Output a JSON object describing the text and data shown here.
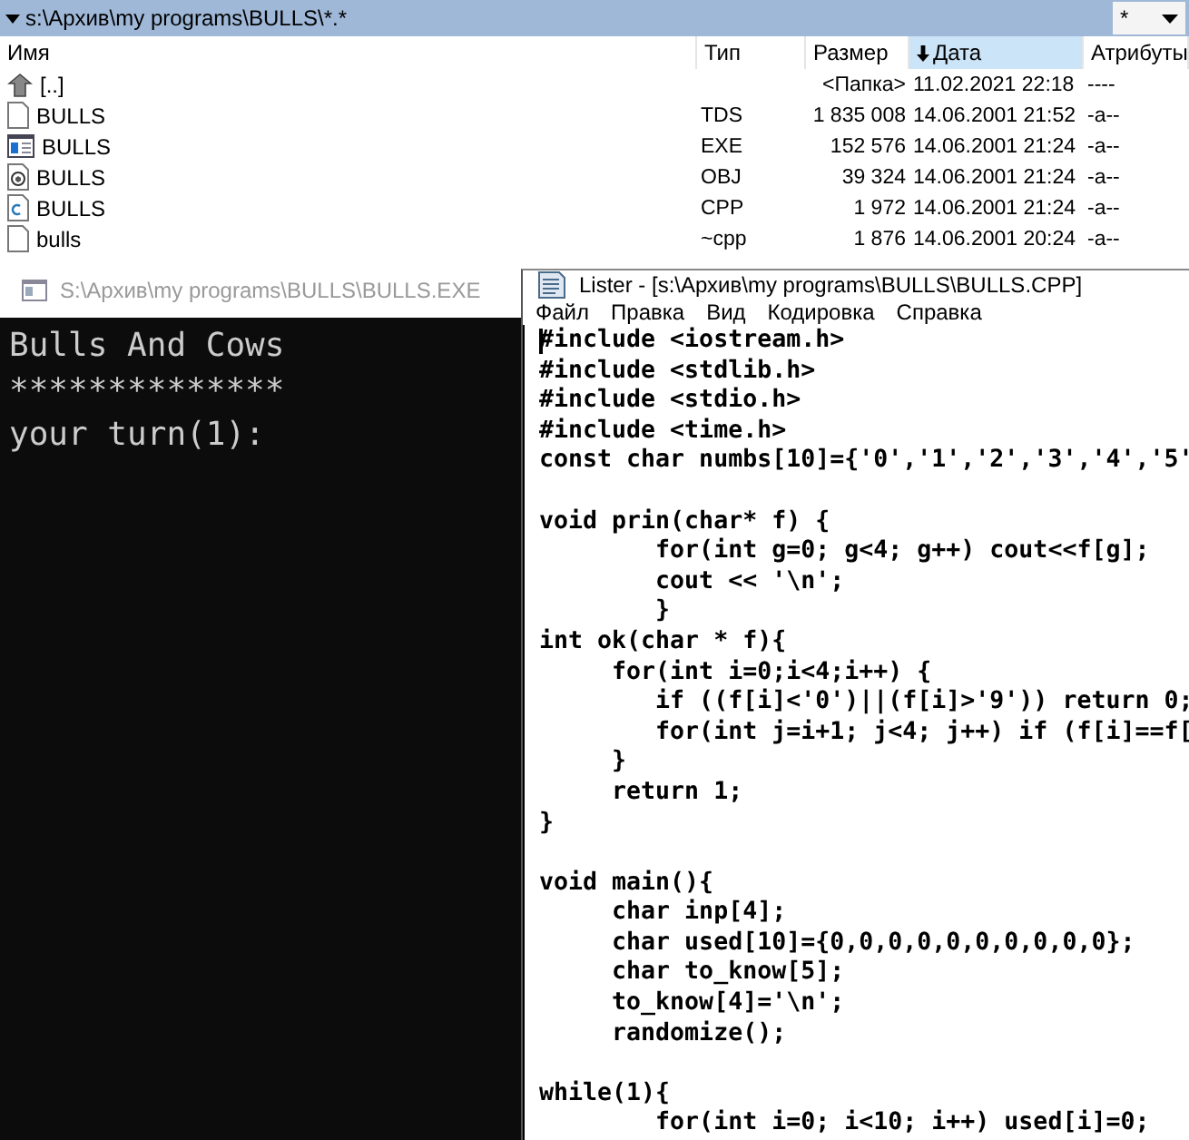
{
  "file_panel": {
    "path": "s:\\Архив\\my programs\\BULLS\\*.*",
    "filter_button": "*",
    "columns": [
      {
        "label": "Имя",
        "sorted": false
      },
      {
        "label": "Тип",
        "sorted": false
      },
      {
        "label": "Размер",
        "sorted": false
      },
      {
        "label": "Дата",
        "sorted": true
      },
      {
        "label": "Атрибуты",
        "sorted": false
      }
    ],
    "rows": [
      {
        "kind": "up",
        "name": "[..]",
        "size": "<Папка>",
        "date": "11.02.2021 22:18",
        "attributes": "----"
      },
      {
        "kind": "file",
        "name": "BULLS",
        "type": "TDS",
        "size": "1 835 008",
        "date": "14.06.2001 21:52",
        "attributes": "-a--"
      },
      {
        "kind": "exe",
        "name": "BULLS",
        "type": "EXE",
        "size": "152 576",
        "date": "14.06.2001 21:24",
        "attributes": "-a--"
      },
      {
        "kind": "obj",
        "name": "BULLS",
        "type": "OBJ",
        "size": "39 324",
        "date": "14.06.2001 21:24",
        "attributes": "-a--"
      },
      {
        "kind": "cpp",
        "name": "BULLS",
        "type": "CPP",
        "size": "1 972",
        "date": "14.06.2001 21:24",
        "attributes": "-a--"
      },
      {
        "kind": "file",
        "name": "bulls",
        "type": "~cpp",
        "size": "1 876",
        "date": "14.06.2001 20:24",
        "attributes": "-a--"
      }
    ]
  },
  "console": {
    "title": "S:\\Архив\\my programs\\BULLS\\BULLS.EXE",
    "lines": [
      "Bulls And Cows",
      "**************",
      "your turn(1):"
    ]
  },
  "lister": {
    "title": "Lister - [s:\\Архив\\my programs\\BULLS\\BULLS.CPP]",
    "menu": [
      "Файл",
      "Правка",
      "Вид",
      "Кодировка",
      "Справка"
    ],
    "code_blocks": [
      [
        "#include <iostream.h>",
        "#include <stdlib.h>",
        "#include <stdio.h>",
        "#include <time.h>",
        "const char numbs[10]={'0','1','2','3','4','5'"
      ],
      [
        "void prin(char* f) {",
        "        for(int g=0; g<4; g++) cout<<f[g];",
        "        cout << '\\n';",
        "        }",
        "int ok(char * f){",
        "     for(int i=0;i<4;i++) {",
        "        if ((f[i]<'0')||(f[i]>'9')) return 0;",
        "        for(int j=i+1; j<4; j++) if (f[i]==f[",
        "     }",
        "     return 1;",
        "}"
      ],
      [
        "void main(){",
        "     char inp[4];",
        "     char used[10]={0,0,0,0,0,0,0,0,0,0};",
        "     char to_know[5];",
        "     to_know[4]='\\n';",
        "     randomize();"
      ],
      [
        "while(1){",
        "        for(int i=0; i<10; i++) used[i]=0;"
      ]
    ]
  }
}
